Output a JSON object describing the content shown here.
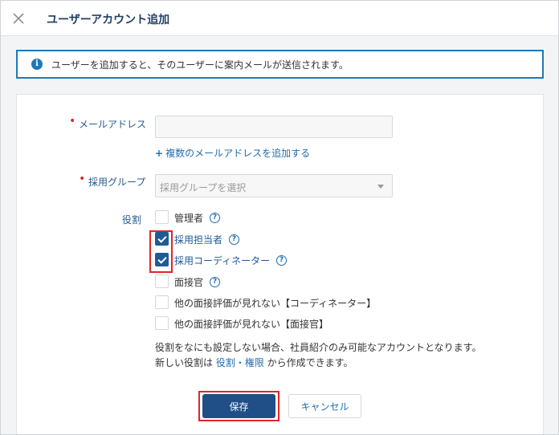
{
  "dialog": {
    "title": "ユーザーアカウント追加",
    "close_icon": "close-icon"
  },
  "notice": {
    "icon": "info-icon",
    "icon_glyph": "i",
    "text": "ユーザーを追加すると、そのユーザーに案内メールが送信されます。"
  },
  "form": {
    "required_mark": "•",
    "email": {
      "label": "メールアドレス",
      "value": "",
      "placeholder": ""
    },
    "add_email_link": {
      "plus": "+",
      "text": "複数のメールアドレスを追加する"
    },
    "group": {
      "label": "採用グループ",
      "placeholder": "採用グループを選択"
    },
    "roles": {
      "label": "役割",
      "help_glyph": "?",
      "items": [
        {
          "label": "管理者",
          "checked": false,
          "help": true
        },
        {
          "label": "採用担当者",
          "checked": true,
          "help": true
        },
        {
          "label": "採用コーディネーター",
          "checked": true,
          "help": true
        },
        {
          "label": "面接官",
          "checked": false,
          "help": true
        },
        {
          "label": "他の面接評価が見れない【コーディネーター】",
          "checked": false,
          "help": false
        },
        {
          "label": "他の面接評価が見れない【面接官】",
          "checked": false,
          "help": false
        }
      ]
    },
    "hint": {
      "line1": "役割をなにも設定しない場合、社員紹介のみ可能なアカウントとなります。",
      "line2_prefix": "新しい役割は ",
      "line2_link": "役割・権限",
      "line2_suffix": " から作成できます。"
    }
  },
  "buttons": {
    "save": "保存",
    "cancel": "キャンセル"
  },
  "colors": {
    "accent": "#1f5a98",
    "title": "#1f3f66",
    "link": "#1f6db0",
    "required": "#e0252b",
    "highlight": "#e0252b"
  }
}
